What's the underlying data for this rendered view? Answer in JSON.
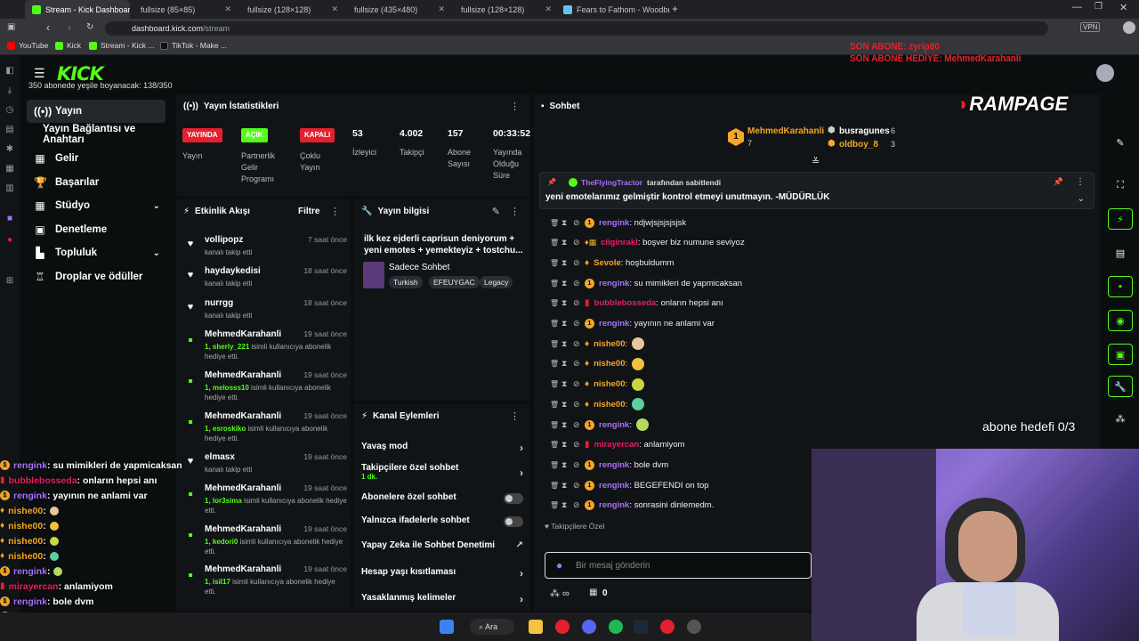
{
  "browser": {
    "tabs": [
      {
        "title": "Stream - Kick Dashboard",
        "active": true
      },
      {
        "title": "fullsize (85×85)"
      },
      {
        "title": "fullsize (128×128)"
      },
      {
        "title": "fullsize (435×480)"
      },
      {
        "title": "fullsize (128×128)"
      },
      {
        "title": "Fears to Fathom - Woodbu"
      }
    ],
    "url_host": "dashboard.kick.com",
    "url_path": "/stream",
    "bookmarks": [
      "YouTube",
      "Kick",
      "Stream - Kick ...",
      "TikTok - Make ..."
    ]
  },
  "overlay": {
    "last_sub": "SON ABONE: zyrip80",
    "last_gift": "SON ABONE HEDİYE: MehmedKarahanli",
    "sub_goal_bar": "350 abonede yeşile boyanacak: 138/350",
    "sponsor": "RAMPAGE",
    "abone_hedefi": "abone hedefi 0/3",
    "chat": [
      {
        "user": "rengink",
        "color": "#a970ff",
        "msg": ": su mimikleri de yapmicaksan",
        "badge": "coin"
      },
      {
        "user": "bubblebosseda",
        "color": "#e91e63",
        "msg": ": onların hepsi anı",
        "badge": "gift"
      },
      {
        "user": "rengink",
        "color": "#a970ff",
        "msg": ": yayının ne anlami var",
        "badge": "coin"
      },
      {
        "user": "nishe00",
        "color": "#f5a623",
        "msg": " :",
        "badge": "flame"
      },
      {
        "user": "nishe00",
        "color": "#f5a623",
        "msg": " :",
        "badge": "flame"
      },
      {
        "user": "nishe00",
        "color": "#f5a623",
        "msg": " :",
        "badge": "flame"
      },
      {
        "user": "nishe00",
        "color": "#f5a623",
        "msg": " :",
        "badge": "flame"
      },
      {
        "user": "rengink",
        "color": "#a970ff",
        "msg": " :",
        "badge": "coin"
      },
      {
        "user": "mirayercan",
        "color": "#e91e63",
        "msg": " : anlamiyom",
        "badge": "gift"
      },
      {
        "user": "rengink",
        "color": "#a970ff",
        "msg": " : bole dvm",
        "badge": "coin"
      },
      {
        "user": "rengink",
        "color": "#a970ff",
        "msg": " : BEGEFENDI on top",
        "badge": "coin"
      },
      {
        "user": "rengink",
        "color": "#a970ff",
        "msg": " : sonrasini dinlemedm.",
        "badge": "coin"
      }
    ]
  },
  "sidebar": {
    "items": [
      {
        "label": "Yayın",
        "icon": "broadcast-icon"
      },
      {
        "label": "Yayın Bağlantısı ve Anahtarı",
        "icon": ""
      },
      {
        "label": "Gelir",
        "icon": "dollar-icon"
      },
      {
        "label": "Başarılar",
        "icon": "trophy-icon"
      },
      {
        "label": "Stüdyo",
        "icon": "studio-icon"
      },
      {
        "label": "Denetleme",
        "icon": "shield-icon"
      },
      {
        "label": "Topluluk",
        "icon": "community-icon"
      },
      {
        "label": "Droplar ve ödüller",
        "icon": "gift-icon"
      }
    ]
  },
  "stats": {
    "title": "Yayın İstatistikleri",
    "badges": [
      {
        "text": "YAYINDA",
        "label": "Yayın"
      },
      {
        "text": "AÇIK",
        "label": "Partnerlik Gelir Programı"
      },
      {
        "text": "KAPALI",
        "label": "Çoklu Yayın"
      }
    ],
    "values": [
      {
        "value": "53",
        "label": "İzleyici"
      },
      {
        "value": "4.002",
        "label": "Takipçi"
      },
      {
        "value": "157",
        "label": "Abone Sayısı"
      },
      {
        "value": "00:33:52",
        "label": "Yayında Olduğu Süre"
      }
    ]
  },
  "activity": {
    "title": "Etkinlik Akışı",
    "filter": "Filtre",
    "items": [
      {
        "name": "vollipopz",
        "time": "7 saat önce",
        "desc": "kanalı takip etti",
        "kind": "follow"
      },
      {
        "name": "haydaykedisi",
        "time": "18 saat önce",
        "desc": "kanalı takip etti",
        "kind": "follow"
      },
      {
        "name": "nurrgg",
        "time": "18 saat önce",
        "desc": "kanalı takip etti",
        "kind": "follow"
      },
      {
        "name": "MehmedKarahanli",
        "time": "19 saat önce",
        "gift": "1, sherly_221",
        "desc": " isimli kullanıcıya abonelik hediye etti.",
        "kind": "gift"
      },
      {
        "name": "MehmedKarahanli",
        "time": "19 saat önce",
        "gift": "1, melosss10",
        "desc": " isimli kullanıcıya abonelik hediye etti.",
        "kind": "gift"
      },
      {
        "name": "MehmedKarahanli",
        "time": "19 saat önce",
        "gift": "1, esroskiko",
        "desc": " isimli kullanıcıya abonelik hediye etti.",
        "kind": "gift"
      },
      {
        "name": "elmasx",
        "time": "19 saat önce",
        "desc": "kanalı takip etti",
        "kind": "follow"
      },
      {
        "name": "MehmedKarahanli",
        "time": "19 saat önce",
        "gift": "1, lor3sima",
        "desc": " isimli kullanıcıya abonelik hediye etti.",
        "kind": "gift"
      },
      {
        "name": "MehmedKarahanli",
        "time": "19 saat önce",
        "gift": "1, kedori0",
        "desc": " isimli kullanıcıya abonelik hediye etti.",
        "kind": "gift"
      },
      {
        "name": "MehmedKarahanli",
        "time": "19 saat önce",
        "gift": "1, isil17",
        "desc": " isimli kullanıcıya abonelik hediye etti.",
        "kind": "gift"
      }
    ]
  },
  "info": {
    "title": "Yayın bilgisi",
    "stream_title": "ilk kez ejderli caprisun deniyorum + yeni emotes + yemekteyiz + tostchu...",
    "category": "Sadece Sohbet",
    "tags": [
      "Turkish",
      "EFEUYGAC",
      "Legacy"
    ]
  },
  "actions": {
    "title": "Kanal Eylemleri",
    "items": [
      {
        "label": "Yavaş mod",
        "type": "arrow"
      },
      {
        "label": "Takipçilere özel sohbet",
        "sub": "1 dk.",
        "type": "arrow"
      },
      {
        "label": "Abonelere özel sohbet",
        "type": "toggle"
      },
      {
        "label": "Yalnızca ifadelerle sohbet",
        "type": "toggle"
      },
      {
        "label": "Yapay Zeka ile Sohbet Denetimi",
        "type": "external"
      },
      {
        "label": "Hesap yaşı kısıtlaması",
        "type": "arrow"
      },
      {
        "label": "Yasaklanmış kelimeler",
        "type": "arrow"
      }
    ]
  },
  "chat": {
    "title": "Sohbet",
    "top_gifters": [
      {
        "name": "MehmedKarahanli",
        "count": "7",
        "rank": "1"
      },
      {
        "name": "busragunes",
        "count": "6"
      },
      {
        "name": "oldboy_8",
        "count": "3"
      }
    ],
    "pinned_by": "TheFlyingTractor",
    "pinned_suffix": "tarafından sabitlendi",
    "pinned_msg": "yeni emotelarımız gelmiştir kontrol etmeyi unutmayın. -MÜDÜRLÜK",
    "messages": [
      {
        "user": "rengink",
        "color": "#a970ff",
        "msg": ": ndjwjsjsjsjsjsk",
        "badge": "coin"
      },
      {
        "user": "ciiginrakl",
        "color": "#e91e63",
        "msg": ": boşver biz numune seviyoz",
        "badge": "flame-gift"
      },
      {
        "user": "Sevole",
        "color": "#f5a623",
        "msg": ": hoşbuldumm",
        "badge": "flame"
      },
      {
        "user": "rengink",
        "color": "#a970ff",
        "msg": ": su mimikleri de yapmicaksan",
        "badge": "coin"
      },
      {
        "user": "bubblebosseda",
        "color": "#e91e63",
        "msg": ": onların hepsi anı",
        "badge": "gift"
      },
      {
        "user": "rengink",
        "color": "#a970ff",
        "msg": ": yayının ne anlami var",
        "badge": "coin"
      },
      {
        "user": "nishe00",
        "color": "#f5a623",
        "msg": ":",
        "badge": "flame"
      },
      {
        "user": "nishe00",
        "color": "#f5a623",
        "msg": ":",
        "badge": "flame"
      },
      {
        "user": "nishe00",
        "color": "#f5a623",
        "msg": ":",
        "badge": "flame"
      },
      {
        "user": "nishe00",
        "color": "#f5a623",
        "msg": ":",
        "badge": "flame"
      },
      {
        "user": "rengink",
        "color": "#a970ff",
        "msg": ":",
        "badge": "coin"
      },
      {
        "user": "mirayercan",
        "color": "#e91e63",
        "msg": ": anlamiyom",
        "badge": "gift"
      },
      {
        "user": "rengink",
        "color": "#a970ff",
        "msg": ": bole dvm",
        "badge": "coin"
      },
      {
        "user": "rengink",
        "color": "#a970ff",
        "msg": ": BEGEFENDI on top",
        "badge": "coin"
      },
      {
        "user": "rengink",
        "color": "#a970ff",
        "msg": ": sonrasini dinlemedm.",
        "badge": "coin"
      }
    ],
    "followers_only": "Takipçilere Özel",
    "input_placeholder": "Bir mesaj gönderin",
    "points": "0"
  },
  "taskbar": {
    "search": "Ara"
  },
  "colors": {
    "accent": "#53fc18",
    "live": "#e5202e",
    "bg": "#0b0e0f",
    "panel": "#111416"
  }
}
